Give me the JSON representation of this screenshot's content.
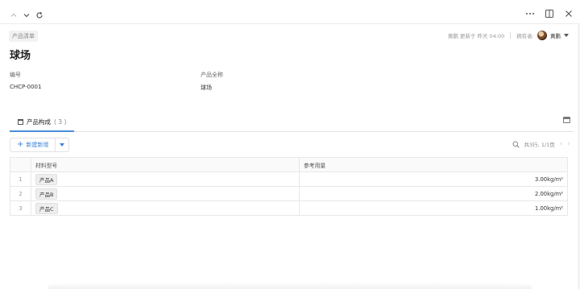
{
  "topbar": {
    "up_icon": "chevron-up-icon",
    "down_icon": "chevron-down-icon",
    "refresh_icon": "refresh-icon",
    "more_icon": "more-icon",
    "layout_icon": "layout-icon",
    "close_icon": "close-icon"
  },
  "header": {
    "category_tag": "产品清单",
    "title": "球场",
    "modified_text": "黄鹏 更新于 昨天 04:00",
    "owner_label": "拥有者:",
    "owner_name": "黄鹏"
  },
  "fields": {
    "code_label": "编号",
    "code_value": "CHCP-0001",
    "fullname_label": "产品全称",
    "fullname_value": "球场"
  },
  "tab": {
    "label": "产品构成",
    "count": "( 3 )"
  },
  "toolbar": {
    "add_label": "新建新增",
    "summary": "共3行, 1/1页"
  },
  "table": {
    "columns": [
      "材料型号",
      "参考用量"
    ],
    "rows": [
      {
        "index": "1",
        "material": "产品A",
        "amount": "3.00kg/m²"
      },
      {
        "index": "2",
        "material": "产品B",
        "amount": "2.00kg/m²"
      },
      {
        "index": "3",
        "material": "产品C",
        "amount": "1.00kg/m²"
      }
    ]
  },
  "colors": {
    "accent": "#3b82d8",
    "tab_underline": "#4a90d9"
  }
}
